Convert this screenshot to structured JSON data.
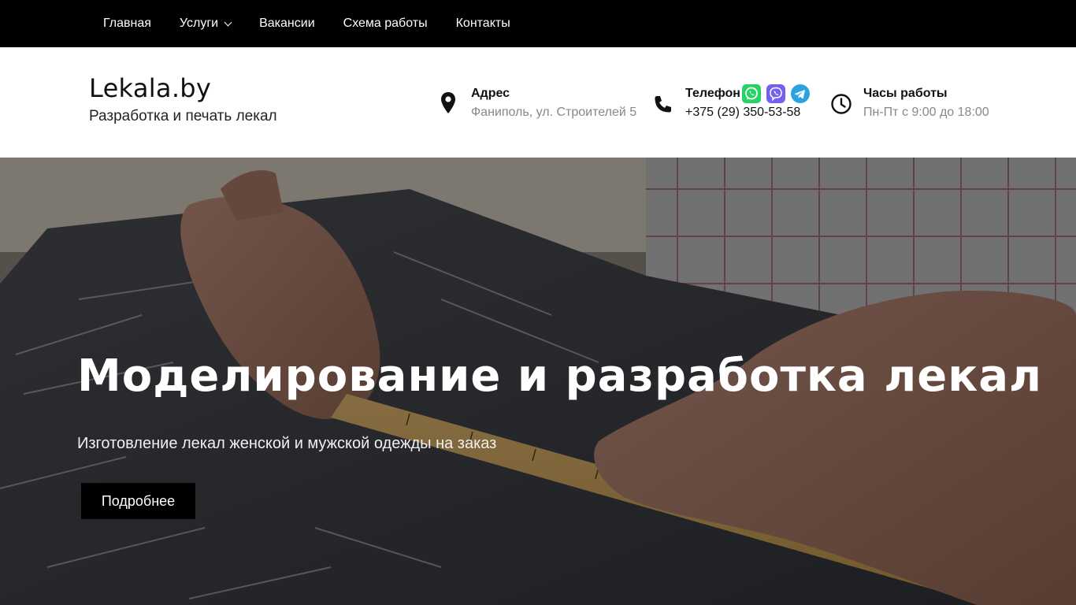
{
  "nav": {
    "items": [
      {
        "label": "Главная"
      },
      {
        "label": "Услуги"
      },
      {
        "label": "Вакансии"
      },
      {
        "label": "Схема работы"
      },
      {
        "label": "Контакты"
      }
    ]
  },
  "header": {
    "logo": "Lekala.by",
    "tagline": "Разработка и печать лекал",
    "address": {
      "title": "Адрес",
      "value": "Фаниполь, ул. Строителей 5",
      "icon": "map-pin-icon"
    },
    "phone": {
      "title": "Телефон",
      "value": "+375 (29) 350-53-58",
      "icon": "phone-icon",
      "messengers": [
        "whatsapp-icon",
        "viber-icon",
        "telegram-icon"
      ]
    },
    "hours": {
      "title": "Часы работы",
      "value": "Пн-Пт с 9:00 до 18:00",
      "icon": "clock-icon"
    }
  },
  "hero": {
    "title": "Моделирование и разработка лекал",
    "subtitle": "Изготовление лекал женской и мужской одежды на заказ",
    "button": "Подробнее"
  },
  "colors": {
    "nav_bg": "#000000",
    "whatsapp": "#25D366",
    "viber": "#7360F2",
    "telegram": "#2AA3DF"
  }
}
